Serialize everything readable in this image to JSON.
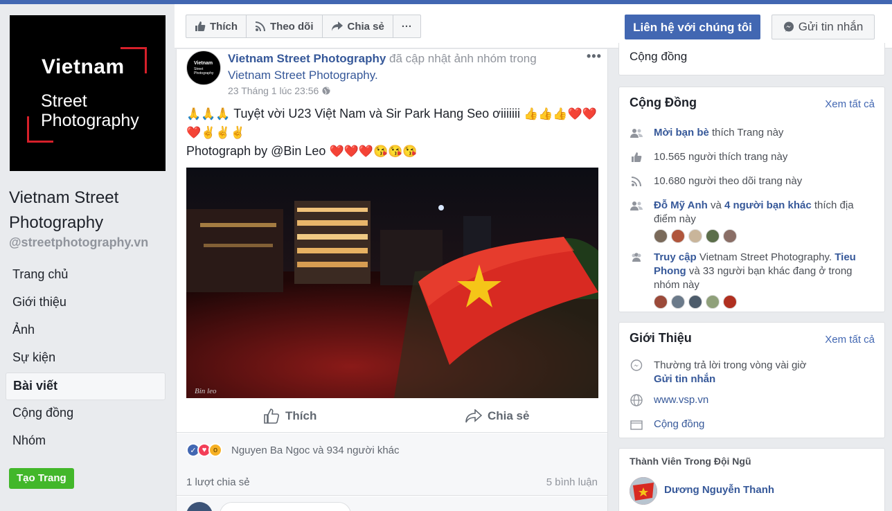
{
  "page": {
    "logo": {
      "line1": "Vietnam",
      "line2": "Street",
      "line3": "Photography"
    },
    "name": "Vietnam Street Photography",
    "handle": "@streetphotography.vn"
  },
  "nav": {
    "items": [
      {
        "label": "Trang chủ"
      },
      {
        "label": "Giới thiệu"
      },
      {
        "label": "Ảnh"
      },
      {
        "label": "Sự kiện"
      },
      {
        "label": "Bài viết"
      },
      {
        "label": "Cộng đồng"
      },
      {
        "label": "Nhóm"
      }
    ],
    "active": "Bài viết",
    "create_button": "Tạo Trang"
  },
  "header": {
    "like": "Thích",
    "follow": "Theo dõi",
    "share": "Chia sẻ",
    "more": "···",
    "contact": "Liên hệ với chúng tôi",
    "message": "Gửi tin nhắn"
  },
  "post": {
    "avatar": {
      "line1": "Vietnam",
      "line2": "Street",
      "line3": "Photography"
    },
    "author": "Vietnam Street Photography",
    "action_text": "đã cập nhật ảnh nhóm trong",
    "group": "Vietnam Street Photography.",
    "time": "23 Tháng 1 lúc 23:56",
    "more": "•••",
    "text_line1": "Tuyệt vời U23 Việt Nam và Sir Park Hang Seo ơiiiiiii",
    "text_line2": "Photograph by @Bin Leo",
    "emoji_prefix": "🙏🙏🙏",
    "emoji_suffix1": "👍👍👍❤️❤️",
    "emoji_suffix2": "❤️✌️✌️✌️",
    "emoji_suffix3": "❤️❤️❤️😘😘😘",
    "photo_signature": "Bin leo",
    "like_label": "Thích",
    "share_label": "Chia sẻ",
    "reactions_text": "Nguyen Ba Ngoc và 934 người khác",
    "shares_text": "1 lượt chia sẻ",
    "comments_text": "5 bình luận"
  },
  "sidebar": {
    "community_top": "Cộng đồng",
    "community": {
      "title": "Cộng Đồng",
      "see_all": "Xem tất cả",
      "invite_link": "Mời bạn bè",
      "invite_rest": "thích Trang này",
      "likes": "10.565 người thích trang này",
      "follows": "10.680 người theo dõi trang này",
      "friend_name": "Đỗ Mỹ Anh",
      "friend_and": "và",
      "friend_others": "4 người bạn khác",
      "friend_rest": "thích địa điểm này",
      "visit_link": "Truy cập",
      "visit_mid": "Vietnam Street Photography.",
      "visit_name": "Tieu Phong",
      "visit_rest": "và 33 người bạn khác đang ở trong nhóm này"
    },
    "about": {
      "title": "Giới Thiệu",
      "see_all": "Xem tất cả",
      "response": "Thường trả lời trong vòng vài giờ",
      "send_message": "Gửi tin nhắn",
      "website": "www.vsp.vn",
      "category": "Cộng đồng"
    },
    "team": {
      "title": "Thành Viên Trong Đội Ngũ",
      "member": "Dương Nguyễn Thanh"
    }
  },
  "colors": {
    "brand": "#4267b2",
    "link": "#365899",
    "create": "#42b72a",
    "logo_accent": "#d6202a"
  }
}
